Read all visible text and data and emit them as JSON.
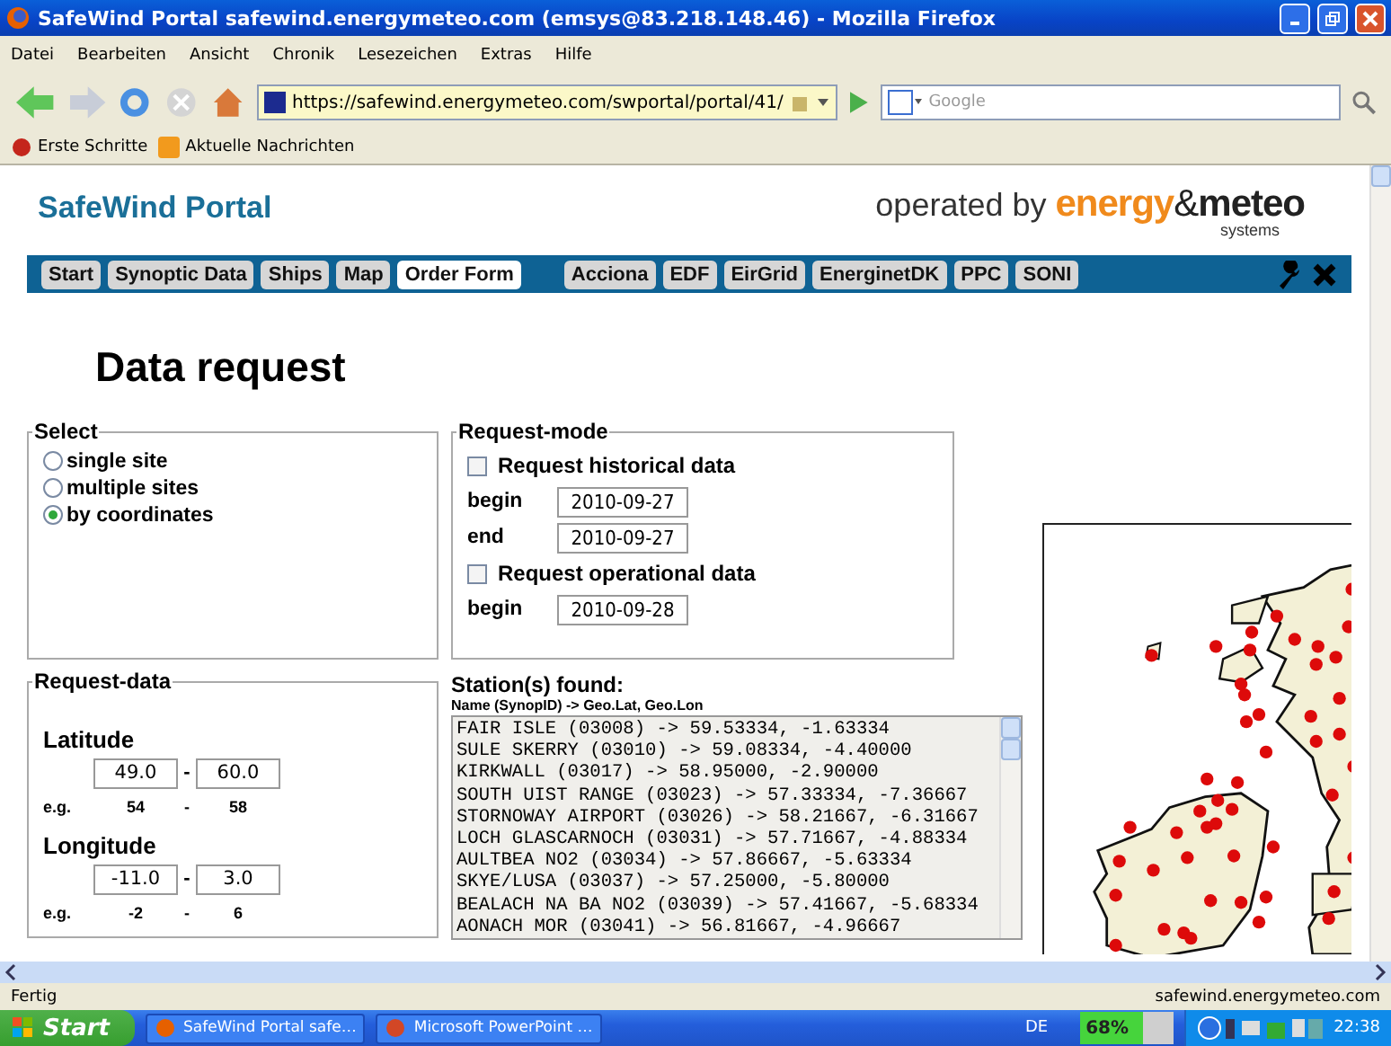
{
  "window": {
    "title": "SafeWind Portal safewind.energymeteo.com (emsys@83.218.148.46) - Mozilla Firefox"
  },
  "menu": [
    "Datei",
    "Bearbeiten",
    "Ansicht",
    "Chronik",
    "Lesezeichen",
    "Extras",
    "Hilfe"
  ],
  "address": {
    "url": "https://safewind.energymeteo.com/swportal/portal/41/"
  },
  "search": {
    "placeholder": "Google"
  },
  "bookmarks": [
    "Erste Schritte",
    "Aktuelle Nachrichten"
  ],
  "header": {
    "title": "SafeWind Portal",
    "logo": {
      "prefix": "operated by",
      "brand": "energy",
      "amp": "&",
      "brand2": "meteo",
      "sub": "systems"
    }
  },
  "nav": {
    "main": [
      {
        "label": "Start",
        "selected": false
      },
      {
        "label": "Synoptic Data",
        "selected": false
      },
      {
        "label": "Ships",
        "selected": false
      },
      {
        "label": "Map",
        "selected": false
      },
      {
        "label": "Order Form",
        "selected": true
      }
    ],
    "clients": [
      {
        "label": "Acciona",
        "selected": false
      },
      {
        "label": "EDF",
        "selected": false
      },
      {
        "label": "EirGrid",
        "selected": false
      },
      {
        "label": "EnerginetDK",
        "selected": false
      },
      {
        "label": "PPC",
        "selected": false
      },
      {
        "label": "SONI",
        "selected": false
      }
    ]
  },
  "heading": "Data request",
  "select": {
    "legend": "Select",
    "options": [
      {
        "label": "single site",
        "selected": false
      },
      {
        "label": "multiple sites",
        "selected": false
      },
      {
        "label": "by coordinates",
        "selected": true
      }
    ]
  },
  "request_mode": {
    "legend": "Request-mode",
    "historical": {
      "label": "Request historical data",
      "checked": false,
      "fields": [
        {
          "label": "begin",
          "value": "2010-09-27"
        },
        {
          "label": "end",
          "value": "2010-09-27"
        }
      ]
    },
    "operational": {
      "label": "Request operational data",
      "checked": false,
      "fields": [
        {
          "label": "begin",
          "value": "2010-09-28"
        }
      ]
    }
  },
  "request_data": {
    "legend": "Request-data",
    "ranges": [
      {
        "label": "Latitude",
        "from": "49.0",
        "separator": "-",
        "to": "60.0",
        "example": {
          "label": "e.g.",
          "from": "54",
          "separator": "-",
          "to": "58"
        }
      },
      {
        "label": "Longitude",
        "from": "-11.0",
        "separator": "-",
        "to": "3.0",
        "example": {
          "label": "e.g.",
          "from": "-2",
          "separator": "-",
          "to": "6"
        }
      }
    ]
  },
  "stations": {
    "title": "Station(s) found:",
    "subtitle": "Name (SynopID) -> Geo.Lat, Geo.Lon",
    "rows": [
      "FAIR ISLE (03008) -> 59.53334, -1.63334",
      "SULE SKERRY (03010) -> 59.08334, -4.40000",
      "KIRKWALL (03017) -> 58.95000, -2.90000",
      "SOUTH UIST RANGE (03023) -> 57.33334, -7.36667",
      "STORNOWAY AIRPORT (03026) -> 58.21667, -6.31667",
      "LOCH GLASCARNOCH (03031) -> 57.71667, -4.88334",
      "AULTBEA NO2 (03034) -> 57.86667, -5.63334",
      "SKYE/LUSA (03037) -> 57.25000, -5.80000",
      "BEALACH NA BA NO2 (03039) -> 57.41667, -5.68334",
      "AONACH MOR (03041) -> 56.81667, -4.96667"
    ]
  },
  "status": {
    "text": "Fertig",
    "domain": "safewind.energymeteo.com"
  },
  "taskbar": {
    "start": "Start",
    "tasks": [
      "SafeWind Portal safe…",
      "Microsoft PowerPoint …"
    ],
    "language": "DE",
    "battery": {
      "reading": "68%",
      "level": 0.68
    },
    "clock": "22:38"
  }
}
